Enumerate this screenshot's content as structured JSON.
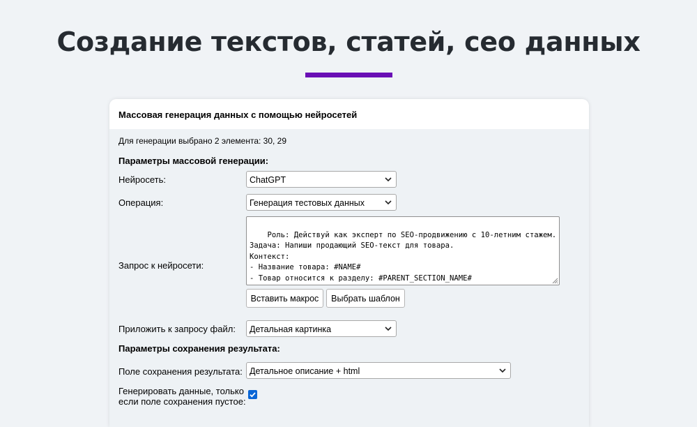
{
  "page": {
    "title": "Создание текстов, статей, сео данных"
  },
  "dialog": {
    "title": "Массовая генерация данных с помощью нейросетей",
    "selected_info": "Для генерации выбрано 2 элемента: 30, 29",
    "params_section": "Параметры массовой генерации:",
    "network": {
      "label": "Нейросеть:",
      "value": "ChatGPT"
    },
    "operation": {
      "label": "Операция:",
      "value": "Генерация тестовых данных"
    },
    "prompt": {
      "label": "Запрос к нейросети:",
      "value": "Роль: Действуй как эксперт по SEO-продвижению с 10-летним стажем.\nЗадача: Напиши продающий SEO-текст для товара.\nКонтекст:\n- Название товара: #NAME#\n- Товар относится к разделу: #PARENT_SECTION_NAME#\n- Параметры товара: #ALL_PROPS#"
    },
    "insert_macro_label": "Вставить макрос",
    "choose_template_label": "Выбрать шаблон",
    "attach_file": {
      "label": "Приложить к запросу файл:",
      "value": "Детальная картинка"
    },
    "save_section": "Параметры сохранения результата:",
    "save_field": {
      "label": "Поле сохранения результата:",
      "value": "Детальное описание + html"
    },
    "only_empty": {
      "label_line1": "Генерировать данные, только",
      "label_line2": "если поле сохранения пустое:",
      "checked": true
    }
  },
  "colors": {
    "accent": "#6a0fb5",
    "checkbox": "#0a66d6",
    "title": "#262b31"
  },
  "icons": {
    "select_arrow": "chevron-down-icon",
    "checkbox": "checkmark-icon",
    "resize": "resize-grip-icon"
  }
}
